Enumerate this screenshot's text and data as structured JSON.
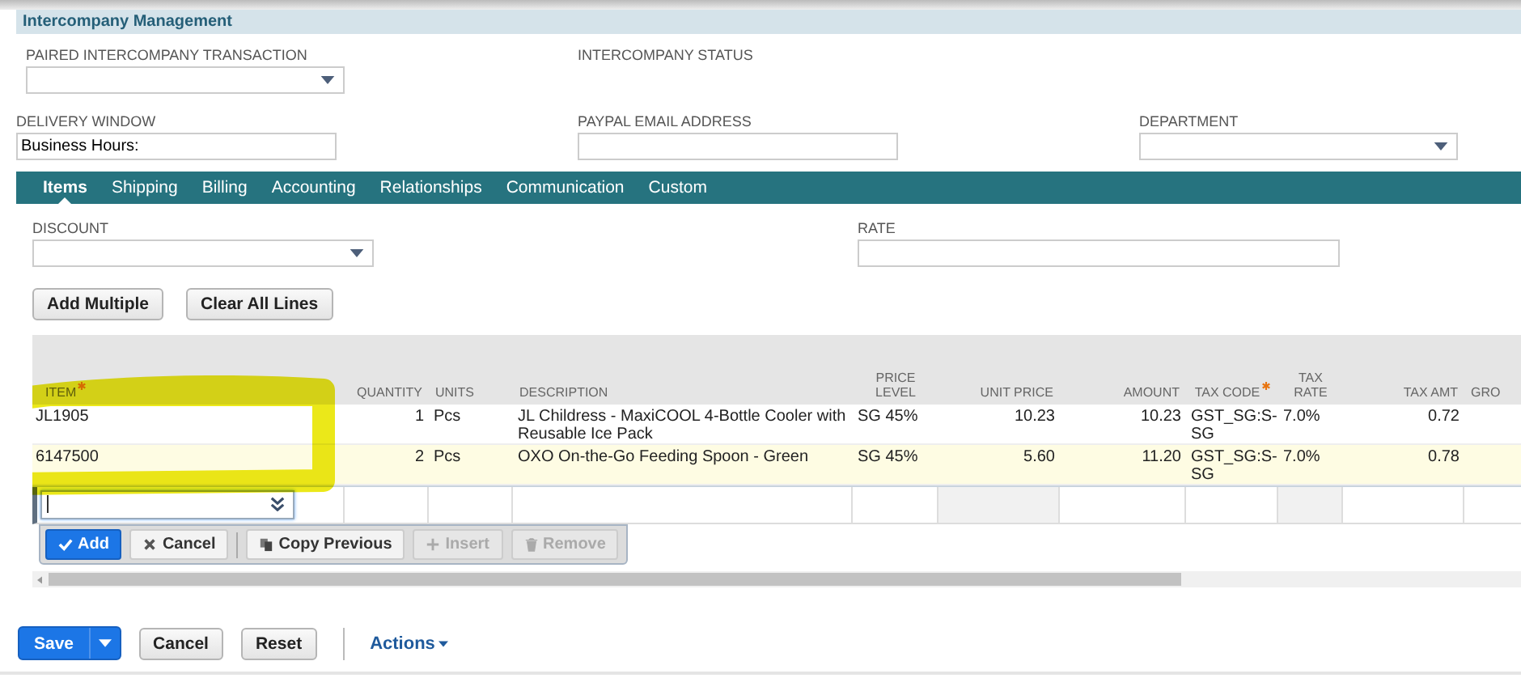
{
  "section": {
    "title": "Intercompany Management"
  },
  "fields": [
    {
      "label": "PAIRED INTERCOMPANY TRANSACTION",
      "kind": "select"
    },
    {
      "label": "INTERCOMPANY STATUS",
      "kind": "readonly"
    },
    {
      "label": "DELIVERY WINDOW",
      "kind": "text",
      "value": "Business Hours:"
    },
    {
      "label": "PAYPAL EMAIL ADDRESS",
      "kind": "text"
    },
    {
      "label": "DEPARTMENT",
      "kind": "select"
    }
  ],
  "tabs": [
    {
      "label": "Items",
      "selected": true
    },
    {
      "label": "Shipping",
      "selected": false
    },
    {
      "label": "Billing",
      "selected": false
    },
    {
      "label": "Accounting",
      "selected": false
    },
    {
      "label": "Relationships",
      "selected": false
    },
    {
      "label": "Communication",
      "selected": false
    },
    {
      "label": "Custom",
      "selected": false
    }
  ],
  "items_fields": [
    {
      "label": "DISCOUNT",
      "kind": "select"
    },
    {
      "label": "RATE",
      "kind": "text"
    }
  ],
  "list_buttons": [
    "Add Multiple",
    "Clear All Lines"
  ],
  "table": {
    "columns": [
      {
        "label": "ITEM",
        "required": true
      },
      {
        "label": "QUANTITY",
        "required": false
      },
      {
        "label": "UNITS",
        "required": false
      },
      {
        "label": "DESCRIPTION",
        "required": false
      },
      {
        "label": "PRICE LEVEL",
        "required": false
      },
      {
        "label": "UNIT PRICE",
        "required": false
      },
      {
        "label": "AMOUNT",
        "required": false
      },
      {
        "label": "TAX CODE",
        "required": true
      },
      {
        "label": "TAX RATE",
        "required": false
      },
      {
        "label": "TAX AMT",
        "required": false
      },
      {
        "label": "GRO",
        "required": false
      }
    ],
    "rows": [
      {
        "selected": false,
        "cells": [
          "JL1905",
          "1",
          "Pcs",
          "JL Childress - MaxiCOOL 4-Bottle Cooler with Reusable Ice Pack",
          "SG 45%",
          "10.23",
          "10.23",
          "GST_SG:S-SG",
          "7.0%",
          "0.72"
        ]
      },
      {
        "selected": true,
        "cells": [
          "6147500",
          "2",
          "Pcs",
          "OXO On-the-Go Feeding Spoon - Green",
          "SG 45%",
          "5.60",
          "11.20",
          "GST_SG:S-SG",
          "7.0%",
          "0.78"
        ]
      }
    ]
  },
  "line_actions": [
    {
      "label": "Add",
      "kind": "confirm",
      "disabled": false
    },
    {
      "label": "Cancel",
      "kind": "cancel",
      "disabled": false
    },
    {
      "label": "Copy Previous",
      "kind": "copy",
      "disabled": false
    },
    {
      "label": "Insert",
      "kind": "insert",
      "disabled": true
    },
    {
      "label": "Remove",
      "kind": "remove",
      "disabled": true
    }
  ],
  "footer": {
    "save": "Save",
    "buttons": [
      "Cancel",
      "Reset"
    ],
    "actions": "Actions"
  }
}
